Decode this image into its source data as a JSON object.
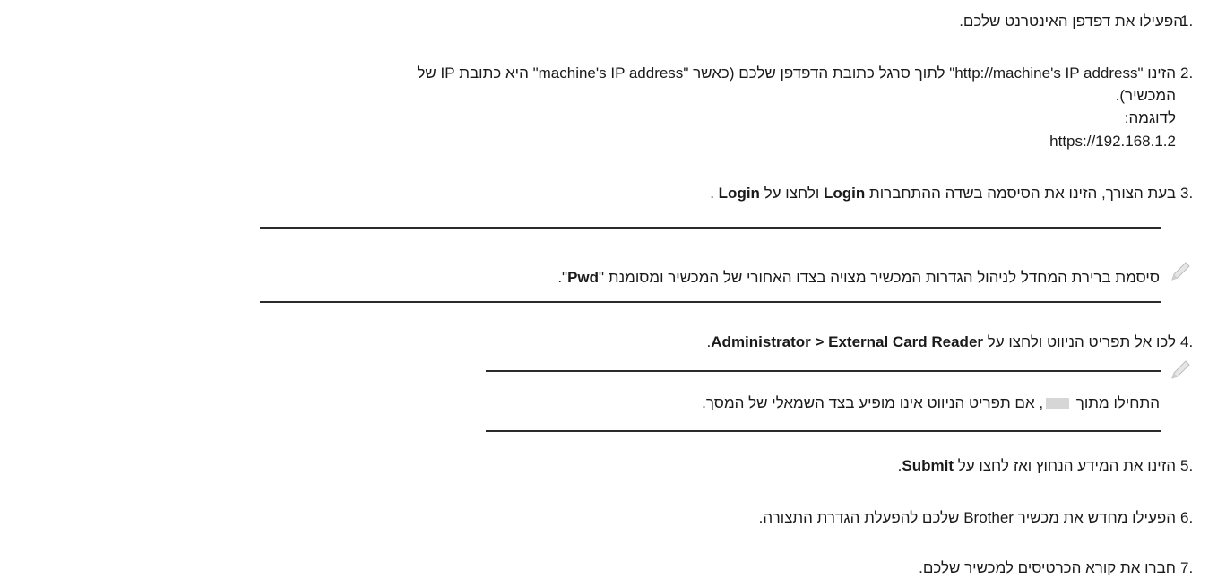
{
  "steps": [
    {
      "num": "1.",
      "text": "הפעילו את דפדפן האינטרנט שלכם."
    },
    {
      "num": "2.",
      "line1": "הזינו \"http://machine's IP address\" לתוך סרגל כתובת הדפדפן שלכם (כאשר \"machine's IP address\" היא כתובת IP של",
      "line2": "המכשיר).",
      "example_label": "לדוגמה:",
      "example_url": "https://192.168.1.2"
    },
    {
      "num": "3.",
      "pre": "בעת הצורך, הזינו את הסיסמה בשדה ההתחברות ",
      "bold1": "Login",
      "mid": " ולחצו על ",
      "bold2": "Login",
      "post": " ."
    },
    {
      "num": "4.",
      "pre": "לכו אל תפריט הניווט ולחצו על ",
      "bold": "Administrator > External Card Reader",
      "post": "."
    },
    {
      "num": "5.",
      "pre": "הזינו את המידע הנחוץ ואז לחצו על ",
      "bold": "Submit",
      "post": "."
    },
    {
      "num": "6.",
      "text": "הפעילו מחדש את מכשיר Brother שלכם להפעלת הגדרת התצורה."
    },
    {
      "num": "7.",
      "text": "חברו את קורא הכרטיסים למכשיר שלכם."
    }
  ],
  "notes": {
    "note1": {
      "pre": "סיסמת ברירת המחדל לניהול הגדרות המכשיר מצויה בצדו האחורי של המכשיר ומסומנת \"",
      "bold": "Pwd",
      "post": "\"."
    },
    "note2": {
      "pre": "התחילו מתוך ",
      "post": ", אם תפריט הניווט אינו מופיע בצד השמאלי של המסך."
    }
  },
  "icons": {
    "note": "pencil-note-icon",
    "menu": "menu-icon"
  }
}
